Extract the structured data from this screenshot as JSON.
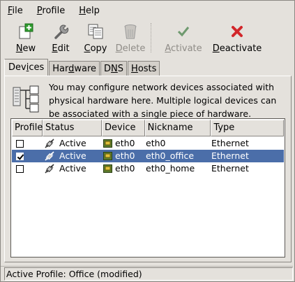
{
  "menubar": {
    "items": [
      {
        "label": "File"
      },
      {
        "label": "Profile"
      },
      {
        "label": "Help"
      }
    ]
  },
  "toolbar": {
    "buttons": [
      {
        "label": "New",
        "icon": "new-icon",
        "enabled": true
      },
      {
        "label": "Edit",
        "icon": "wrench-icon",
        "enabled": true
      },
      {
        "label": "Copy",
        "icon": "copy-icon",
        "enabled": true
      },
      {
        "label": "Delete",
        "icon": "trash-icon",
        "enabled": false
      },
      {
        "label": "Activate",
        "icon": "checkmark-icon",
        "enabled": false
      },
      {
        "label": "Deactivate",
        "icon": "red-x-icon",
        "enabled": true
      }
    ]
  },
  "tabs": [
    {
      "label": "Devices",
      "active": true
    },
    {
      "label": "Hardware",
      "active": false
    },
    {
      "label": "DNS",
      "active": false
    },
    {
      "label": "Hosts",
      "active": false
    }
  ],
  "info": {
    "text": "You may configure network devices associated with physical hardware here.  Multiple logical devices can be associated with a single piece of hardware."
  },
  "devices_table": {
    "columns": [
      "Profile",
      "Status",
      "Device",
      "Nickname",
      "Type"
    ],
    "rows": [
      {
        "profile_checked": false,
        "status": "Active",
        "device": "eth0",
        "nickname": "eth0",
        "type": "Ethernet",
        "selected": false
      },
      {
        "profile_checked": true,
        "status": "Active",
        "device": "eth0",
        "nickname": "eth0_office",
        "type": "Ethernet",
        "selected": true
      },
      {
        "profile_checked": false,
        "status": "Active",
        "device": "eth0",
        "nickname": "eth0_home",
        "type": "Ethernet",
        "selected": false
      }
    ]
  },
  "statusbar": {
    "text": "Active Profile: Office (modified)"
  },
  "colors": {
    "window_bg": "#e4e1dc",
    "selection": "#4b6ea9",
    "deactivate_red": "#d2262a",
    "activate_green": "#3c8a3c"
  }
}
